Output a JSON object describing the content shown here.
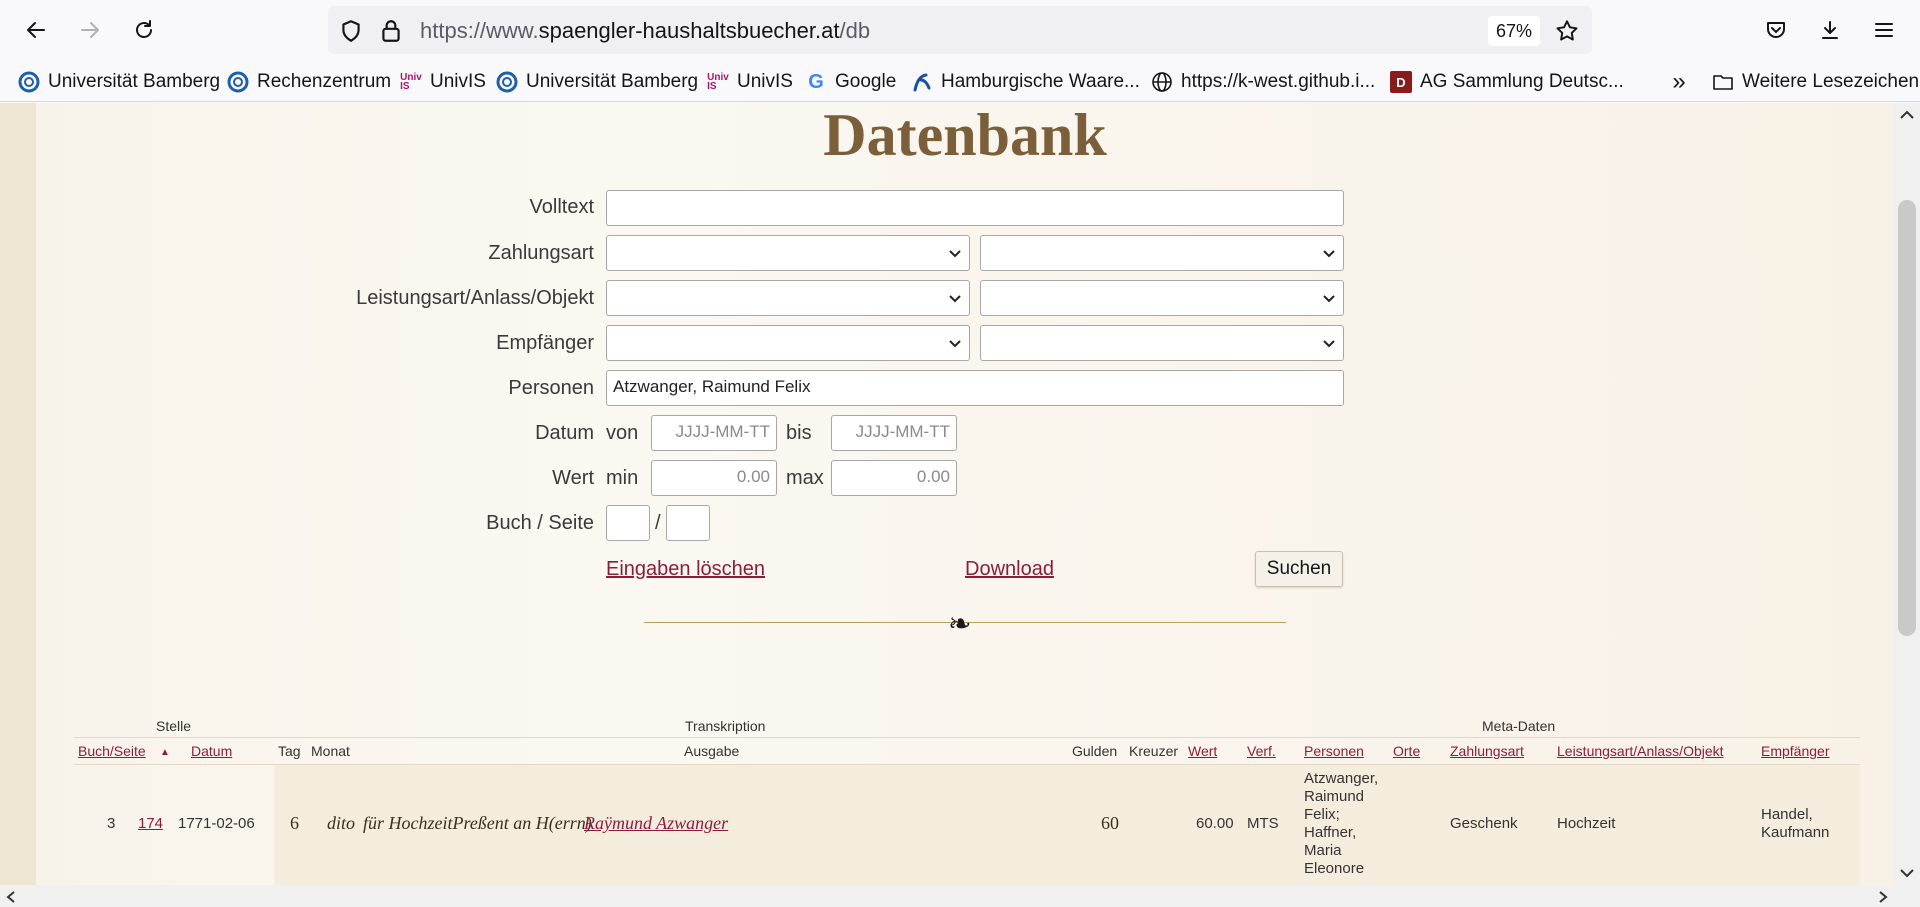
{
  "browser": {
    "url_prefix": "https://www.",
    "url_host": "spaengler-haushaltsbuecher.at",
    "url_path": "/db",
    "zoom": "67%"
  },
  "bookmarks": [
    {
      "label": "Universität Bamberg",
      "icon": "bamberg-icon"
    },
    {
      "label": "Rechenzentrum",
      "icon": "bamberg-icon"
    },
    {
      "label": "UnivIS",
      "icon": "univis-icon"
    },
    {
      "label": "Universität Bamberg",
      "icon": "bamberg-icon"
    },
    {
      "label": "UnivIS",
      "icon": "univis-icon"
    },
    {
      "label": "Google",
      "icon": "google-icon"
    },
    {
      "label": "Hamburgische Waare...",
      "icon": "hamburg-icon"
    },
    {
      "label": "https://k-west.github.i...",
      "icon": "globe-icon"
    },
    {
      "label": "AG Sammlung Deutsc...",
      "icon": "ag-icon"
    }
  ],
  "bookmarks_more": "Weitere Lesezeichen",
  "page": {
    "title": "Datenbank",
    "form": {
      "volltext_label": "Volltext",
      "volltext_value": "",
      "zahlungsart_label": "Zahlungsart",
      "leistungsart_label": "Leistungsart/Anlass/Objekt",
      "empfaenger_label": "Empfänger",
      "personen_label": "Personen",
      "personen_value": "Atzwanger, Raimund Felix",
      "datum_label": "Datum",
      "von": "von",
      "bis": "bis",
      "date_placeholder": "JJJJ-MM-TT",
      "wert_label": "Wert",
      "min": "min",
      "max": "max",
      "value_placeholder": "0.00",
      "buch_seite_label": "Buch / Seite",
      "slash": "/",
      "clear_link": "Eingaben löschen",
      "download_link": "Download",
      "search_button": "Suchen"
    },
    "fleuron": "❧"
  },
  "table": {
    "groups": {
      "stelle": "Stelle",
      "transkription": "Transkription",
      "meta": "Meta-Daten"
    },
    "columns": {
      "buch_seite": "Buch/Seite",
      "sort_indicator": "▲",
      "datum": "Datum",
      "tag": "Tag",
      "monat": "Monat",
      "ausgabe": "Ausgabe",
      "gulden": "Gulden",
      "kreuzer": "Kreuzer",
      "wert": "Wert",
      "verf": "Verf.",
      "personen": "Personen",
      "orte": "Orte",
      "zahlungsart": "Zahlungsart",
      "leistungsart": "Leistungsart/Anlass/Objekt",
      "empfaenger": "Empfänger"
    },
    "rows": [
      {
        "buch": "3",
        "seite": "174",
        "datum": "1771-02-06",
        "tag": "6",
        "monat": "dito",
        "ausgabe_text": "für HochzeitPreßent an H(errn)",
        "ausgabe_link": "Raÿmund Azwanger",
        "gulden": "60",
        "kreuzer": "",
        "wert": "60.00",
        "verf": "MTS",
        "personen": [
          "Atzwanger,",
          "Raimund",
          "Felix;",
          "Haffner,",
          "Maria",
          "Eleonore"
        ],
        "orte": "",
        "zahlungsart": "Geschenk",
        "leistungsart": "Hochzeit",
        "empfaenger": [
          "Handel,",
          "Kaufmann"
        ]
      }
    ]
  }
}
